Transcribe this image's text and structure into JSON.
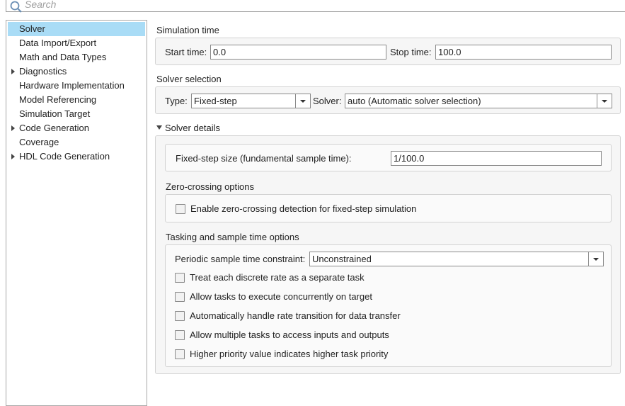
{
  "search": {
    "placeholder": "Search"
  },
  "sidebar": {
    "items": [
      {
        "label": "Solver",
        "selected": true,
        "expandable": false
      },
      {
        "label": "Data Import/Export",
        "expandable": false
      },
      {
        "label": "Math and Data Types",
        "expandable": false
      },
      {
        "label": "Diagnostics",
        "expandable": true
      },
      {
        "label": "Hardware Implementation",
        "expandable": false
      },
      {
        "label": "Model Referencing",
        "expandable": false
      },
      {
        "label": "Simulation Target",
        "expandable": false
      },
      {
        "label": "Code Generation",
        "expandable": true
      },
      {
        "label": "Coverage",
        "expandable": false
      },
      {
        "label": "HDL Code Generation",
        "expandable": true
      }
    ]
  },
  "simulation_time": {
    "title": "Simulation time",
    "start_label": "Start time:",
    "start_value": "0.0",
    "stop_label": "Stop time:",
    "stop_value": "100.0"
  },
  "solver_selection": {
    "title": "Solver selection",
    "type_label": "Type:",
    "type_value": "Fixed-step",
    "solver_label": "Solver:",
    "solver_value": "auto (Automatic solver selection)"
  },
  "solver_details": {
    "title": "Solver details",
    "step_size_label": "Fixed-step size (fundamental sample time):",
    "step_size_value": "1/100.0",
    "zero_crossing": {
      "title": "Zero-crossing options",
      "enable_label": "Enable zero-crossing detection for fixed-step simulation",
      "enable_checked": false
    },
    "tasking": {
      "title": "Tasking and sample time options",
      "constraint_label": "Periodic sample time constraint:",
      "constraint_value": "Unconstrained",
      "options": [
        {
          "label": "Treat each discrete rate as a separate task",
          "checked": false
        },
        {
          "label": "Allow tasks to execute concurrently on target",
          "checked": false
        },
        {
          "label": "Automatically handle rate transition for data transfer",
          "checked": false
        },
        {
          "label": "Allow multiple tasks to access inputs and outputs",
          "checked": false
        },
        {
          "label": "Higher priority value indicates higher task priority",
          "checked": false
        }
      ]
    }
  },
  "icons": {
    "search": "search-icon",
    "expand": "triangle-right-icon",
    "collapse": "triangle-down-icon",
    "dropdown": "chevron-down-icon"
  },
  "colors": {
    "selection": "#a9dcf6",
    "panel_bg": "#f6f6f6",
    "border": "#d3d3d3"
  }
}
